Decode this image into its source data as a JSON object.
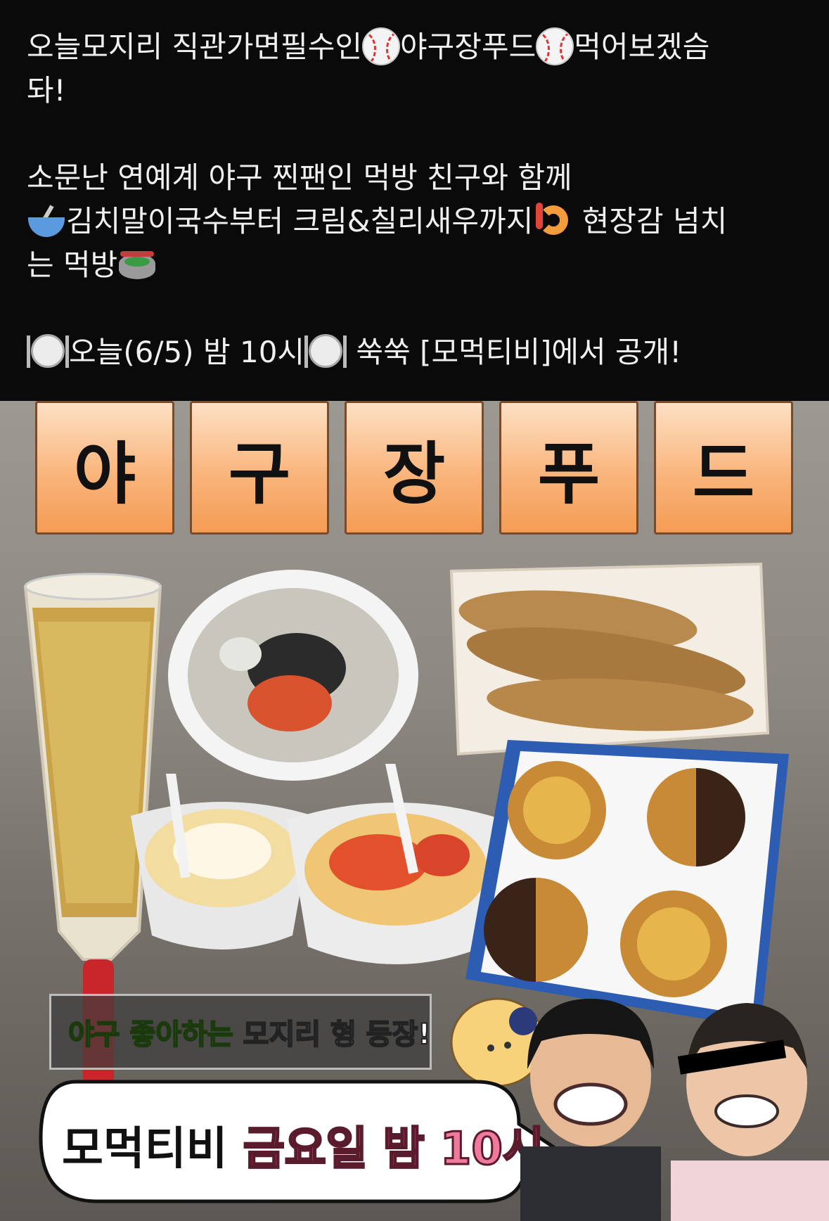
{
  "post": {
    "line1": "오늘모지리 직관가면필수인",
    "line1b": "야구장푸드",
    "line1c": "먹어보겠슴",
    "line2": "돠!",
    "line3": "소문난 연예계 야구 찐팬인 먹방 친구와 함께",
    "line4": "김치말이국수부터 크림&칠리새우까지",
    "line4b": " 현장감 넘치",
    "line5": "는 먹방",
    "line6a": "오늘(6/5) 밤 10시",
    "line6b": " 쑥쑥 [모먹티비]에서 공개!"
  },
  "thumbnail": {
    "tiles": [
      "야",
      "구",
      "장",
      "푸",
      "드"
    ],
    "caption_green": "야구 좋아하는",
    "caption_white": " 모지리 형 등장!",
    "bubble_black": "모먹티비",
    "bubble_pink": " 금요일 밤 10시"
  },
  "icons": [
    "baseball-icon",
    "bowl-with-spoon-icon",
    "fried-shrimp-icon",
    "stadium-icon",
    "plate-with-cutlery-icon"
  ],
  "colors": {
    "background": "#0a0a0a",
    "text": "#f0f0f0",
    "tile_orange": "#f49c54",
    "caption_green": "#8ee04a",
    "bubble_pink": "#f07a9b"
  }
}
